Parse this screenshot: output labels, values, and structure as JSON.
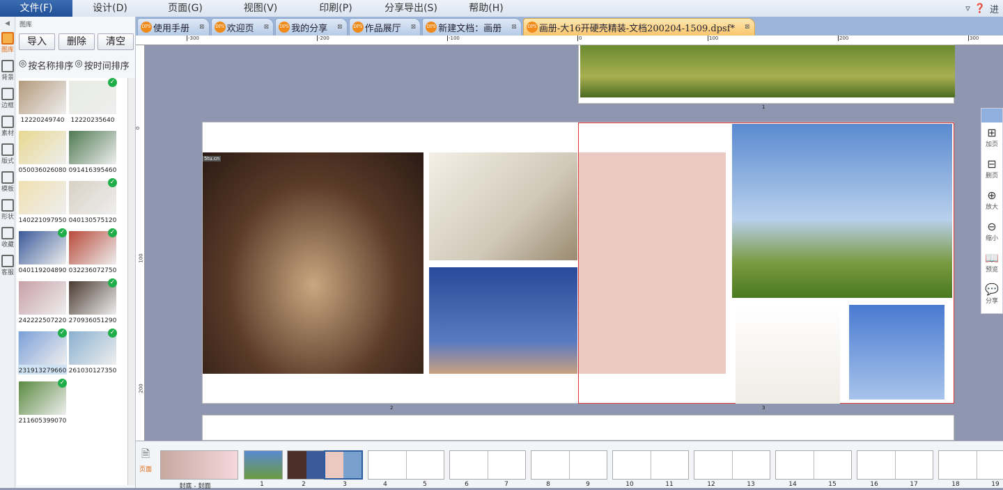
{
  "menu": [
    "文件(F)",
    "设计(D)",
    "页面(G)",
    "视图(V)",
    "印刷(P)",
    "分享导出(S)",
    "帮助(H)"
  ],
  "top_right": {
    "label": "进"
  },
  "side_icons": [
    {
      "label": "图库",
      "icon": "gallery-icon"
    },
    {
      "label": "背景",
      "icon": "background-icon"
    },
    {
      "label": "边框",
      "icon": "border-icon"
    },
    {
      "label": "素材",
      "icon": "material-icon"
    },
    {
      "label": "版式",
      "icon": "layout-icon"
    },
    {
      "label": "模板",
      "icon": "template-icon"
    },
    {
      "label": "形状",
      "icon": "shape-icon"
    },
    {
      "label": "收藏",
      "icon": "star-icon"
    },
    {
      "label": "客服",
      "icon": "chat-icon"
    }
  ],
  "gallery": {
    "title": "图库",
    "buttons": [
      "导入",
      "删除",
      "清空"
    ],
    "sort": [
      "按名称排序",
      "按时间排序"
    ],
    "items": [
      {
        "name": "12220249740",
        "checked": false,
        "color": "#b49a7c"
      },
      {
        "name": "12220235640",
        "checked": true,
        "color": "#e8ece4"
      },
      {
        "name": "050036026080",
        "checked": false,
        "color": "#e8d890"
      },
      {
        "name": "091416395460",
        "checked": false,
        "color": "#4f7a52"
      },
      {
        "name": "140221097950",
        "checked": false,
        "color": "#f0e0b0"
      },
      {
        "name": "040130575120",
        "checked": true,
        "color": "#d8d0c4"
      },
      {
        "name": "040119204890",
        "checked": true,
        "color": "#3a5a9a"
      },
      {
        "name": "032236072750",
        "checked": true,
        "color": "#b84a3a"
      },
      {
        "name": "242222507220",
        "checked": false,
        "color": "#c8a0a8"
      },
      {
        "name": "270936051290",
        "checked": true,
        "color": "#4a3a30"
      },
      {
        "name": "231913279660",
        "checked": true,
        "color": "#7aa0d8",
        "selected": true
      },
      {
        "name": "261030127350",
        "checked": true,
        "color": "#8ab0d0"
      },
      {
        "name": "211605399070",
        "checked": true,
        "color": "#5a8a40"
      }
    ]
  },
  "tabs": [
    {
      "label": "使用手册"
    },
    {
      "label": "欢迎页"
    },
    {
      "label": "我的分享"
    },
    {
      "label": "作品展厅"
    },
    {
      "label": "新建文档：画册"
    },
    {
      "label": "画册-大16开硬壳精装-文档200204-1509.dpsf*",
      "active": true
    }
  ],
  "ruler": {
    "h": [
      "-300",
      "-200",
      "-100",
      "0",
      "100",
      "200",
      "300"
    ],
    "v": [
      "0",
      "100",
      "200"
    ]
  },
  "page_labels": {
    "top": "1",
    "left": "2",
    "right": "3"
  },
  "watermark": "5tu.cn",
  "right_tools": [
    {
      "label": "加页",
      "icon": "add-page-icon",
      "g": "⊞"
    },
    {
      "label": "删页",
      "icon": "delete-page-icon",
      "g": "⊟"
    },
    {
      "label": "放大",
      "icon": "zoom-in-icon",
      "g": "⊕"
    },
    {
      "label": "缩小",
      "icon": "zoom-out-icon",
      "g": "⊖"
    },
    {
      "label": "预览",
      "icon": "book-icon",
      "g": "📖"
    },
    {
      "label": "分享",
      "icon": "wechat-icon",
      "g": "💬"
    }
  ],
  "film": {
    "side_label": "页面",
    "pages": [
      "封底 - 封面",
      "1",
      "2",
      "3",
      "4",
      "5",
      "6",
      "7",
      "8",
      "9",
      "10",
      "11",
      "12",
      "13",
      "14",
      "15",
      "16",
      "17",
      "18",
      "19"
    ]
  }
}
